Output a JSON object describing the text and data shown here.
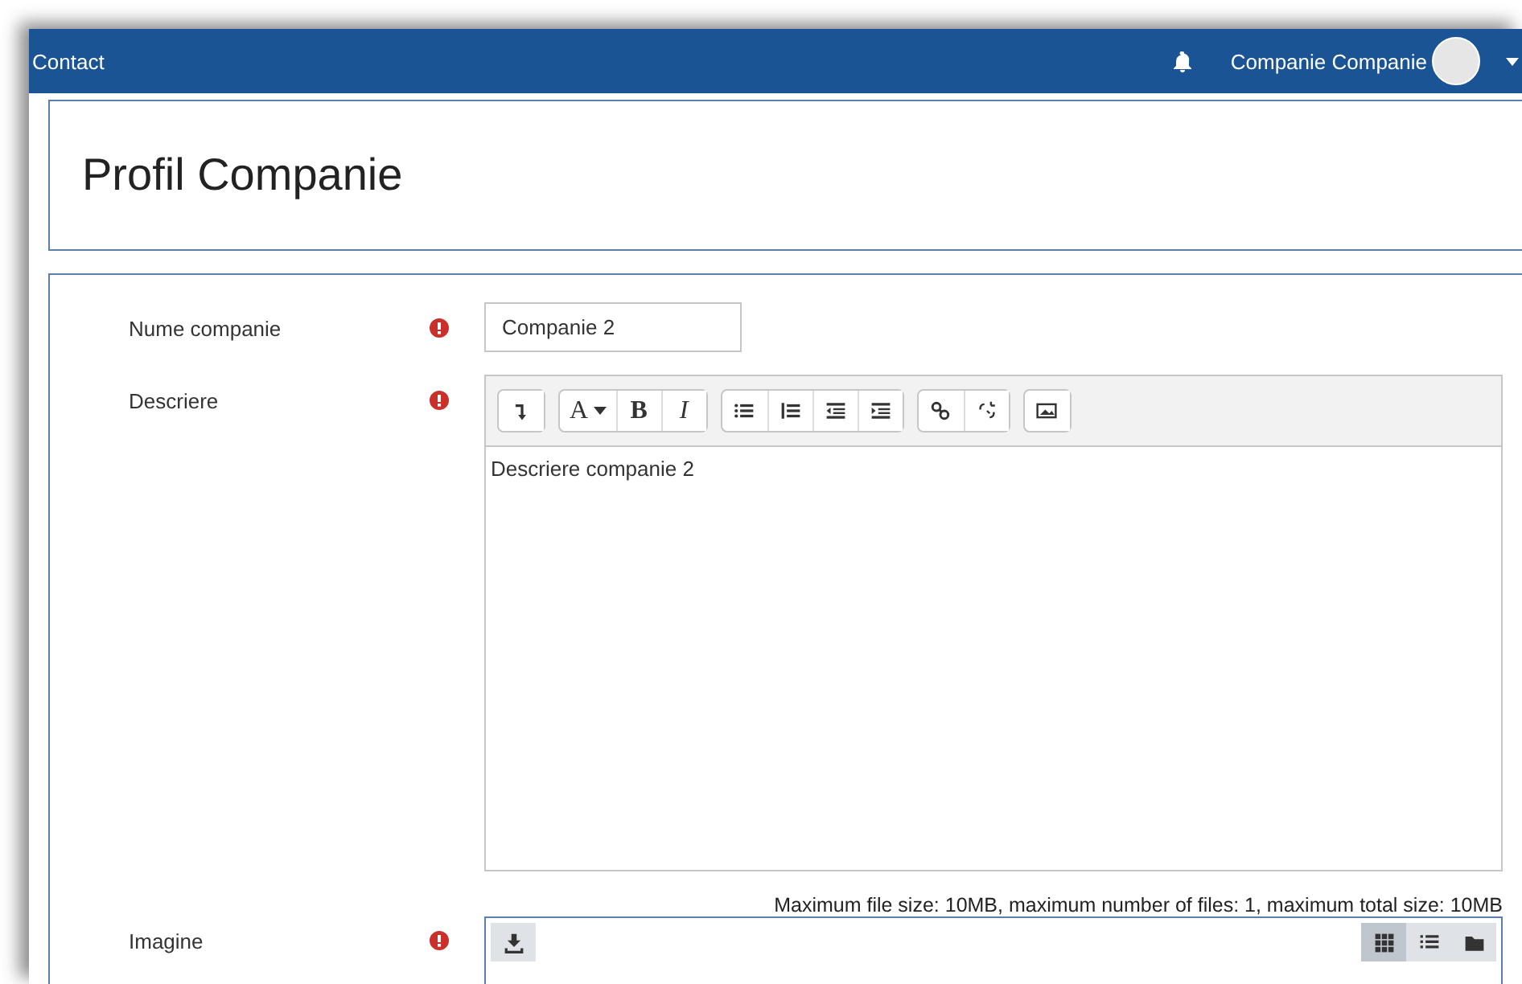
{
  "navbar": {
    "link": "Contact",
    "user": "Companie Companie"
  },
  "header": {
    "title": "Profil Companie"
  },
  "form": {
    "fields": [
      {
        "kind": "text",
        "label": "Nume companie",
        "required": true,
        "value": "Companie 2"
      },
      {
        "kind": "editor",
        "label": "Descriere",
        "required": true,
        "value": "Descriere companie 2"
      },
      {
        "kind": "file",
        "label": "Imagine",
        "required": true,
        "note": "Maximum file size: 10MB, maximum number of files: 1, maximum total size: 10MB"
      }
    ]
  },
  "toolbar": [
    [
      {
        "kind": "icon"
      }
    ],
    [
      {
        "kind": "menu",
        "label": "A"
      },
      {
        "kind": "bold",
        "label": "B"
      },
      {
        "kind": "italic",
        "label": "I"
      }
    ],
    [
      {
        "kind": "icon"
      },
      {
        "kind": "icon"
      },
      {
        "kind": "icon"
      },
      {
        "kind": "icon"
      }
    ],
    [
      {
        "kind": "icon"
      },
      {
        "kind": "icon"
      }
    ],
    [
      {
        "kind": "icon"
      }
    ]
  ],
  "file_views": [
    {
      "selected": true
    },
    {
      "selected": false
    },
    {
      "selected": false
    }
  ]
}
